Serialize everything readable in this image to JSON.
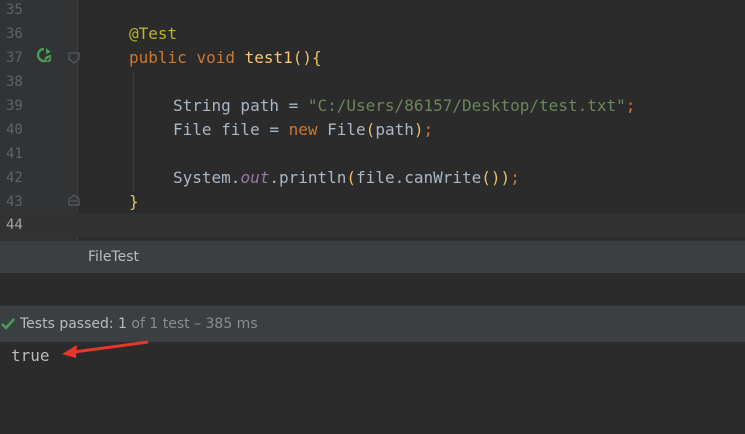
{
  "editor": {
    "line_numbers": [
      "35",
      "36",
      "37",
      "38",
      "39",
      "40",
      "41",
      "42",
      "43",
      "44"
    ],
    "annotation": "@Test",
    "kw_public": "public",
    "kw_void": "void",
    "method_name": "test1",
    "paren_pair": "()",
    "brace_open": "{",
    "type_string": "String",
    "var_path_decl": " path = ",
    "path_literal": "\"C:/Users/86157/Desktop/test.txt\"",
    "semicolon": ";",
    "type_file": "File",
    "var_file_decl": " file = ",
    "kw_new": "new",
    "ctor_name": " File",
    "paren_open": "(",
    "arg_path": "path",
    "paren_close": ")",
    "system": "System.",
    "out_field": "out",
    "println": ".println",
    "arg_expr": "file.canWrite",
    "brace_close": "}"
  },
  "tab": {
    "label": "FileTest"
  },
  "status": {
    "passed_label": "Tests passed: ",
    "passed_count": "1",
    "rest": " of 1 test – 385 ms"
  },
  "console": {
    "output": "true"
  },
  "colors": {
    "accent_arrow": "#e8362b",
    "pass_check": "#499c54"
  }
}
